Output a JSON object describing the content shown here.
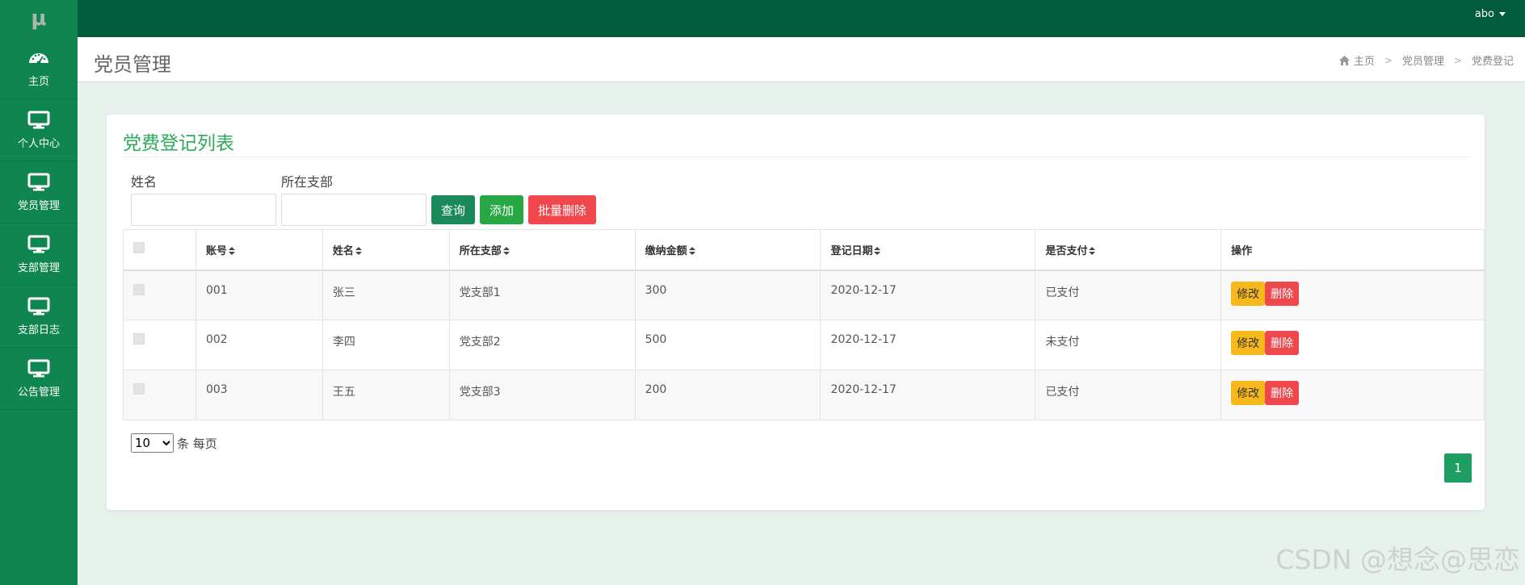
{
  "app": {
    "logo": "μ",
    "user": "abo"
  },
  "sidebar": {
    "items": [
      {
        "label": "主页",
        "icon": "dashboard-icon"
      },
      {
        "label": "个人中心",
        "icon": "monitor-icon"
      },
      {
        "label": "党员管理",
        "icon": "monitor-icon"
      },
      {
        "label": "支部管理",
        "icon": "monitor-icon"
      },
      {
        "label": "支部日志",
        "icon": "monitor-icon"
      },
      {
        "label": "公告管理",
        "icon": "monitor-icon"
      }
    ]
  },
  "header": {
    "title": "党员管理",
    "breadcrumb": [
      "主页",
      "党员管理",
      "党费登记"
    ]
  },
  "card": {
    "title": "党费登记列表",
    "search": {
      "name_label": "姓名",
      "name_value": "",
      "branch_label": "所在支部",
      "branch_value": ""
    },
    "buttons": {
      "query": "查询",
      "add": "添加",
      "batch_delete": "批量删除"
    },
    "table": {
      "headers": [
        "账号",
        "姓名",
        "所在支部",
        "缴纳金额",
        "登记日期",
        "是否支付",
        "操作"
      ],
      "rows": [
        {
          "account": "001",
          "name": "张三",
          "branch": "党支部1",
          "amount": "300",
          "date": "2020-12-17",
          "paid": "已支付"
        },
        {
          "account": "002",
          "name": "李四",
          "branch": "党支部2",
          "amount": "500",
          "date": "2020-12-17",
          "paid": "未支付"
        },
        {
          "account": "003",
          "name": "王五",
          "branch": "党支部3",
          "amount": "200",
          "date": "2020-12-17",
          "paid": "已支付"
        }
      ],
      "edit_label": "修改",
      "delete_label": "删除"
    },
    "page_size": {
      "value": "10",
      "suffix": "条 每页"
    },
    "pagination": {
      "current": "1"
    }
  },
  "watermark": "CSDN @想念@思恋",
  "colors": {
    "sidebar": "#0f8550",
    "topbar": "#005c3d",
    "accent": "#2dab5a",
    "danger": "#f0474d",
    "warning": "#f6b81a"
  }
}
